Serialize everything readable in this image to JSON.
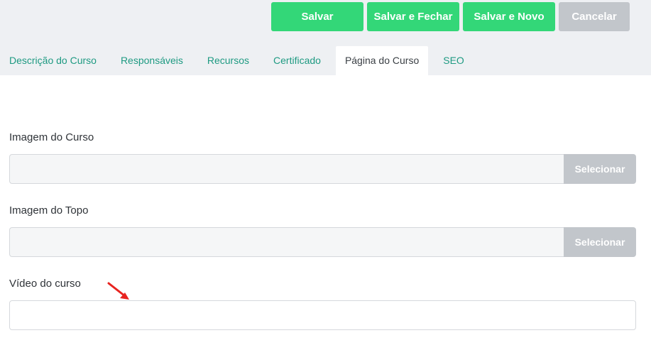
{
  "toolbar": {
    "save_label": "Salvar",
    "save_close_label": "Salvar e Fechar",
    "save_new_label": "Salvar e Novo",
    "cancel_label": "Cancelar"
  },
  "tabs": [
    {
      "label": "Descrição do Curso",
      "active": false
    },
    {
      "label": "Responsáveis",
      "active": false
    },
    {
      "label": "Recursos",
      "active": false
    },
    {
      "label": "Certificado",
      "active": false
    },
    {
      "label": "Página do Curso",
      "active": true
    },
    {
      "label": "SEO",
      "active": false
    }
  ],
  "form": {
    "course_image": {
      "label": "Imagem do Curso",
      "value": "",
      "button_label": "Selecionar"
    },
    "top_image": {
      "label": "Imagem do Topo",
      "value": "",
      "button_label": "Selecionar"
    },
    "course_video": {
      "label": "Vídeo do curso",
      "value": "",
      "placeholder": ""
    }
  },
  "colors": {
    "primary_green": "#33d778",
    "disabled_gray": "#c2c6cb",
    "tab_link": "#1e9a82",
    "header_bg": "#eef0f3",
    "annotation_arrow": "#e8231f"
  },
  "annotation": {
    "icon": "red-arrow-icon"
  }
}
